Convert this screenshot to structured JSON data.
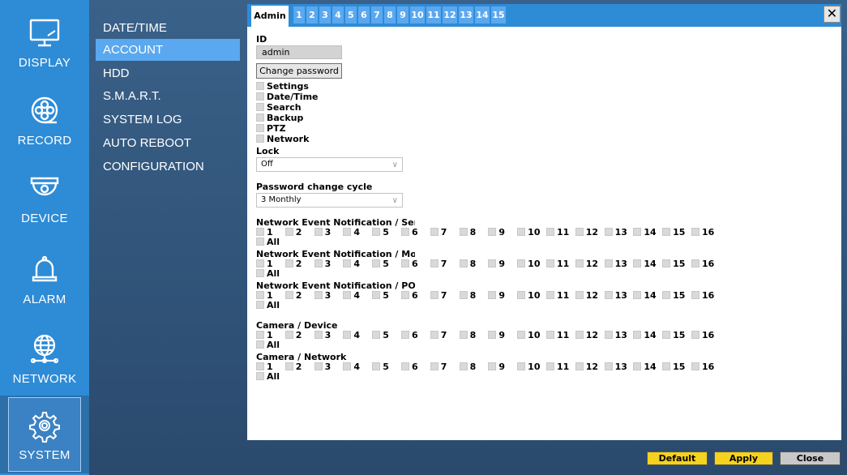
{
  "rail": {
    "items": [
      {
        "label": "DISPLAY",
        "icon": "monitor-icon"
      },
      {
        "label": "RECORD",
        "icon": "film-reel-icon"
      },
      {
        "label": "DEVICE",
        "icon": "dome-camera-icon"
      },
      {
        "label": "ALARM",
        "icon": "bell-icon"
      },
      {
        "label": "NETWORK",
        "icon": "globe-network-icon"
      },
      {
        "label": "SYSTEM",
        "icon": "gear-icon"
      }
    ]
  },
  "submenu": {
    "items": [
      "DATE/TIME",
      "ACCOUNT",
      "HDD",
      "S.M.A.R.T.",
      "SYSTEM LOG",
      "AUTO REBOOT",
      "CONFIGURATION"
    ]
  },
  "tabs": [
    "Admin",
    "1",
    "2",
    "3",
    "4",
    "5",
    "6",
    "7",
    "8",
    "9",
    "10",
    "11",
    "12",
    "13",
    "14",
    "15"
  ],
  "account": {
    "id_label": "ID",
    "id_value": "admin",
    "change_password": "Change password",
    "permissions": [
      "Settings",
      "Date/Time",
      "Search",
      "Backup",
      "PTZ",
      "Network"
    ],
    "lock_label": "Lock",
    "lock_value": "Off",
    "pw_cycle_label": "Password change cycle",
    "pw_cycle_value": "3 Monthly",
    "groups": [
      "Network Event Notification / Sensor",
      "Network Event Notification / Motion",
      "Network Event Notification / POS",
      "Camera / Device",
      "Camera / Network"
    ],
    "channels": [
      "1",
      "2",
      "3",
      "4",
      "5",
      "6",
      "7",
      "8",
      "9",
      "10",
      "11",
      "12",
      "13",
      "14",
      "15",
      "16"
    ],
    "all_label": "All"
  },
  "footer": {
    "default": "Default",
    "apply": "Apply",
    "close": "Close"
  },
  "colors": {
    "rail": "#2e8bd6",
    "active_tab": "#5aa8ef",
    "footer_button": "#f5d21e",
    "close_button": "#c8c8c8"
  }
}
